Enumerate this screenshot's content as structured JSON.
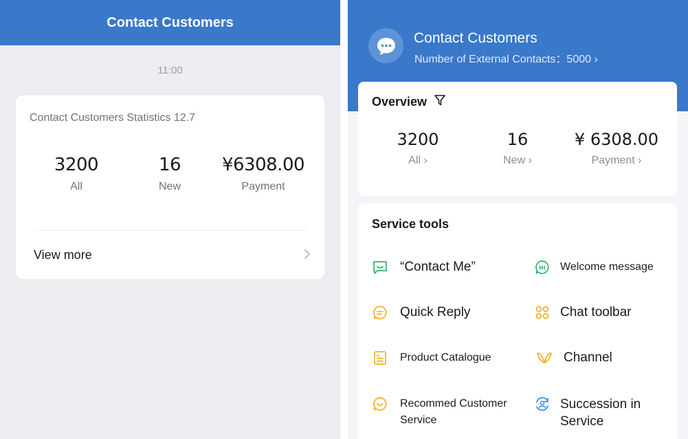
{
  "left": {
    "header_title": "Contact Customers",
    "time": "11:00",
    "card": {
      "title": "Contact Customers Statistics 12.7",
      "stats": [
        {
          "value": "3200",
          "label": "All"
        },
        {
          "value": "16",
          "label": "New"
        },
        {
          "value": "¥6308.00",
          "label": "Payment"
        }
      ],
      "view_more": "View more"
    }
  },
  "right": {
    "header": {
      "title": "Contact Customers",
      "subtitle": "Number of External Contacts：5000 ›"
    },
    "overview": {
      "title": "Overview",
      "stats": [
        {
          "value": "3200",
          "label": "All ›"
        },
        {
          "value": "16",
          "label": "New ›"
        },
        {
          "value": "¥ 6308.00",
          "label": "Payment ›"
        }
      ]
    },
    "tools": {
      "title": "Service tools",
      "items": [
        {
          "label": "“Contact Me”",
          "icon": "chat-smile-icon"
        },
        {
          "label": "Welcome message",
          "icon": "hi-bubble-icon"
        },
        {
          "label": "Quick Reply",
          "icon": "quick-reply-icon"
        },
        {
          "label": "Chat toolbar",
          "icon": "toolbar-icon"
        },
        {
          "label": "Product Catalogue",
          "icon": "catalogue-icon"
        },
        {
          "label": "Channel",
          "icon": "channel-icon"
        },
        {
          "label": "Recommed Customer Service",
          "icon": "recommend-icon"
        },
        {
          "label": "Succession in Service",
          "icon": "succession-icon"
        }
      ]
    }
  },
  "colors": {
    "brand_blue": "#3a78c9",
    "green": "#2bb56b",
    "orange": "#f2b01e",
    "blue_icon": "#3a8ee6"
  }
}
